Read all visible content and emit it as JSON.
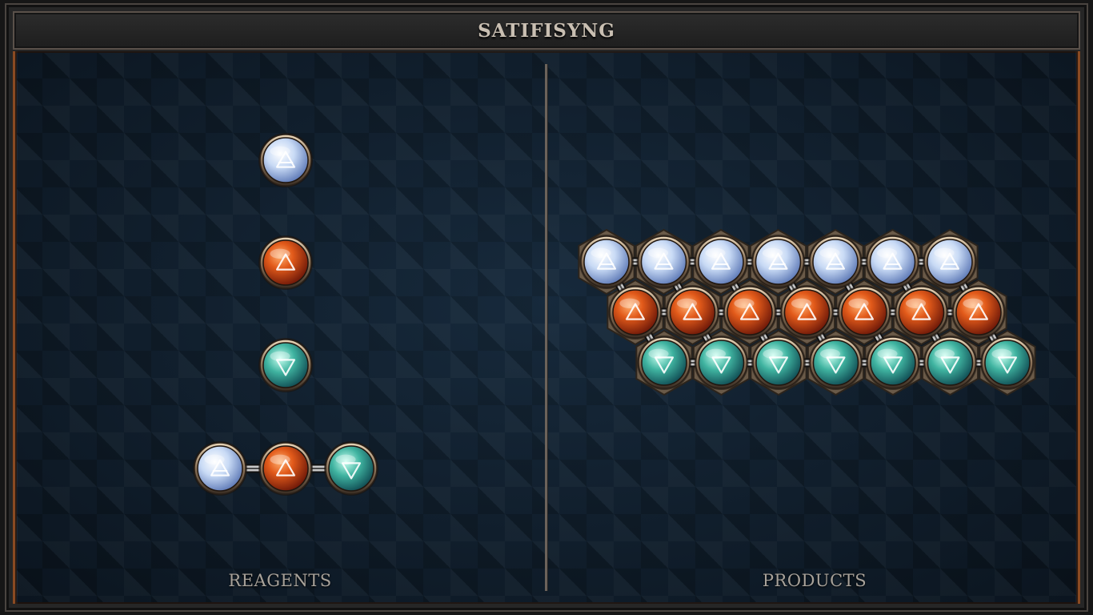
{
  "title": "SATIFISYNG",
  "panels": {
    "left_label": "REAGENTS",
    "right_label": "PRODUCTS"
  },
  "colors": {
    "air": "#b8cff0",
    "fire": "#d8501c",
    "water": "#3aa89a",
    "frame_border": "#8a4a22"
  },
  "atom_symbols": {
    "air": "air-triangle-icon",
    "fire": "fire-triangle-icon",
    "water": "water-triangle-icon"
  },
  "reagents": [
    {
      "kind": "single",
      "atoms": [
        "air"
      ]
    },
    {
      "kind": "single",
      "atoms": [
        "fire"
      ]
    },
    {
      "kind": "single",
      "atoms": [
        "water"
      ]
    },
    {
      "kind": "chain",
      "atoms": [
        "air",
        "fire",
        "water"
      ]
    }
  ],
  "product": {
    "rows": [
      [
        "air",
        "air",
        "air",
        "air",
        "air",
        "air",
        "air"
      ],
      [
        "fire",
        "fire",
        "fire",
        "fire",
        "fire",
        "fire",
        "fire"
      ],
      [
        "water",
        "water",
        "water",
        "water",
        "water",
        "water",
        "water"
      ]
    ]
  }
}
